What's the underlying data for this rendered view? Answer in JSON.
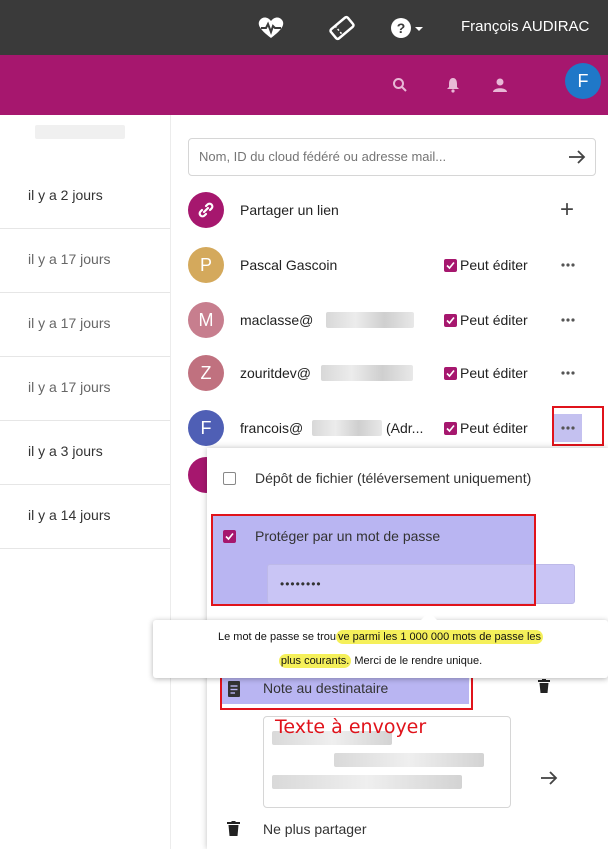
{
  "topbar": {
    "user_name": "François AUDIRAC",
    "icons": [
      "heartbeat-icon",
      "ticket-icon",
      "help-icon"
    ]
  },
  "appbar": {
    "icons": [
      "search-icon",
      "bell-icon",
      "contacts-icon"
    ],
    "avatar_letter": "F",
    "brand_color": "#a6176e"
  },
  "files": {
    "rows": [
      {
        "modified": "il y a 2 jours"
      },
      {
        "modified": "il y a 17 jours"
      },
      {
        "modified": "il y a 17 jours"
      },
      {
        "modified": "il y a 17 jours"
      },
      {
        "modified": "il y a 3 jours"
      },
      {
        "modified": "il y a 14 jours"
      }
    ]
  },
  "sharing": {
    "search_placeholder": "Nom, ID du cloud fédéré ou adresse mail...",
    "share_link_label": "Partager un lien",
    "permission_label": "Peut éditer",
    "shares": [
      {
        "name": "Pascal Gascoin",
        "initial": "P",
        "color": "#d4a95c"
      },
      {
        "name": "maclasse@",
        "initial": "M",
        "color": "#c77e8e"
      },
      {
        "name": "zouritdev@",
        "initial": "Z",
        "color": "#c0717f"
      },
      {
        "name": "francois@",
        "suffix": "(Adr...",
        "initial": "F",
        "color": "#4f5fb5"
      }
    ]
  },
  "menu": {
    "file_drop_label": "Dépôt de fichier (téléversement uniquement)",
    "password_protect_label": "Protéger par un mot de passe",
    "password_value": "••••••••",
    "note_label": "Note au destinataire",
    "unshare_label": "Ne plus partager"
  },
  "tooltip": {
    "part1": "Le mot de passe se trou",
    "part2": "ve parmi les 1 000 000 mots de passe les",
    "part3": "plus courants.",
    "part4": " Merci de le rendre unique."
  },
  "annotation": {
    "text": "Texte à envoyer"
  }
}
